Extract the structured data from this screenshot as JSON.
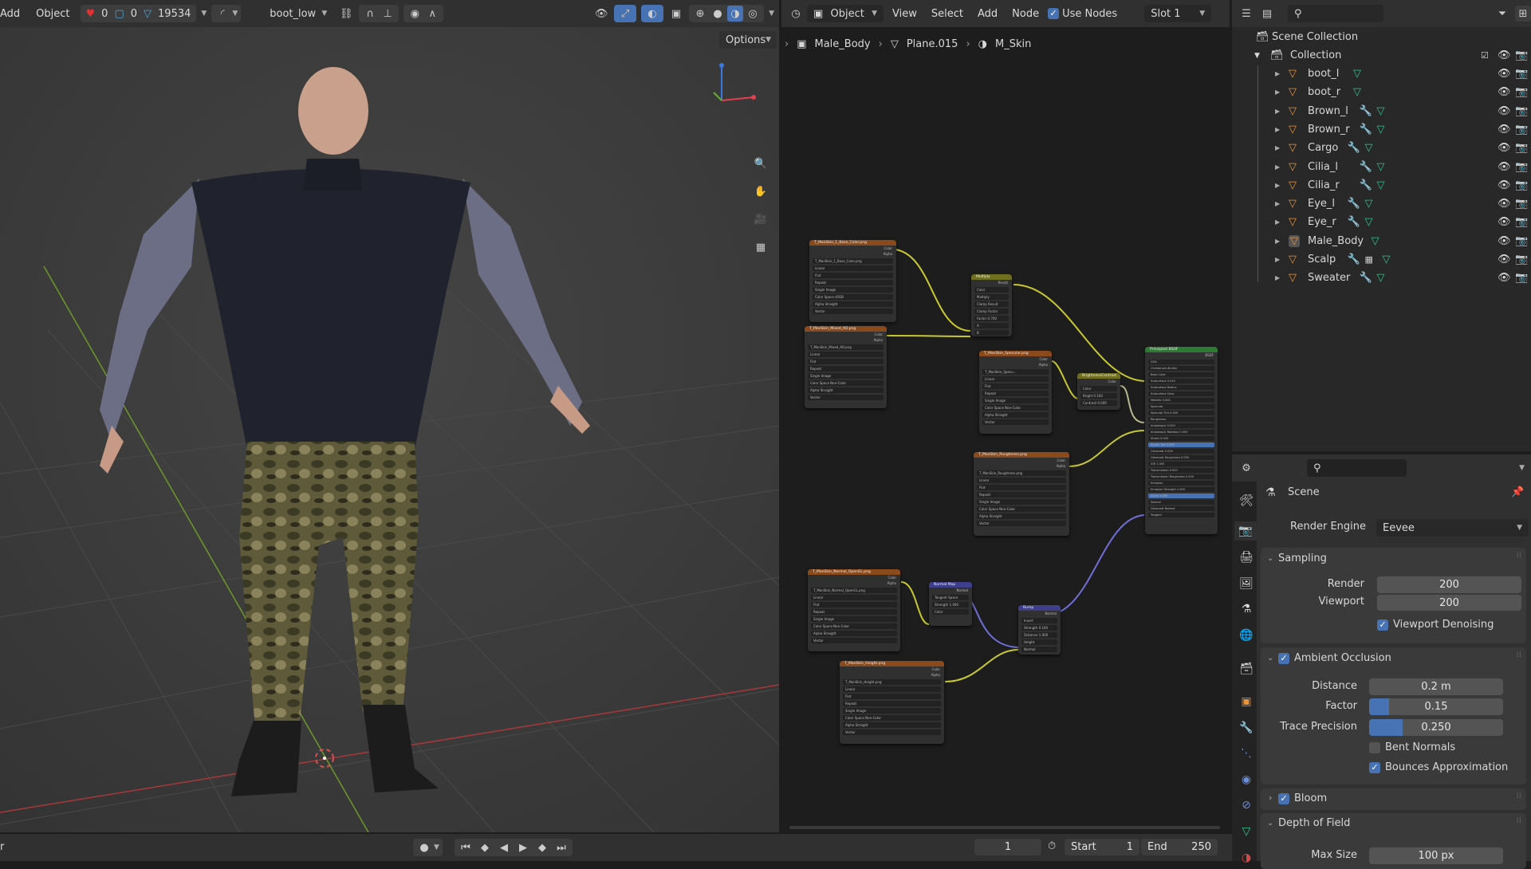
{
  "viewport_header": {
    "menus": [
      "Add",
      "Object"
    ],
    "stats": {
      "bones": "0",
      "faces": "0",
      "verts": "19534"
    },
    "object_select": "boot_low",
    "options": "Options"
  },
  "node_header": {
    "mode": "Object",
    "menus": [
      "View",
      "Select",
      "Add",
      "Node"
    ],
    "use_nodes": "Use Nodes",
    "slot": "Slot 1"
  },
  "breadcrumb": [
    "Male_Body",
    "Plane.015",
    "M_Skin"
  ],
  "nodes": [
    {
      "title": "T_ManSkin_1_Base_Color.png",
      "outputs": [
        "Color",
        "Alpha"
      ],
      "rows": [
        "T_ManSkin_1_Base_Color.png",
        "Linear",
        "Flat",
        "Repeat",
        "Single Image",
        "Color Space   sRGB",
        "Alpha   Straight",
        "Vector"
      ]
    },
    {
      "title": "T_ManSkin_Mixed_AO.png",
      "outputs": [
        "Color",
        "Alpha"
      ],
      "rows": [
        "T_ManSkin_Mixed_AO.png",
        "Linear",
        "Flat",
        "Repeat",
        "Single Image",
        "Color Space   Non-Color",
        "Alpha   Straight",
        "Vector"
      ]
    },
    {
      "title": "Multiply",
      "outputs": [
        "Result"
      ],
      "rows": [
        "Color",
        "Multiply",
        "Clamp Result",
        "Clamp Factor",
        "Factor   0.700",
        "A",
        "B"
      ]
    },
    {
      "title": "T_ManSkin_Specular.png",
      "outputs": [
        "Color",
        "Alpha"
      ],
      "rows": [
        "T_ManSkin_Specu...",
        "Linear",
        "Flat",
        "Repeat",
        "Single Image",
        "Color Space   Non-Color",
        "Alpha   Straight",
        "Vector"
      ]
    },
    {
      "title": "BrightnessContrast",
      "outputs": [
        "Color"
      ],
      "rows": [
        "Color",
        "Bright   0.100",
        "Contrast   0.000"
      ]
    },
    {
      "title": "Principled BSDF",
      "outputs": [
        "BSDF"
      ],
      "rows": [
        "GGX",
        "Christensen-Burley",
        "Base Color",
        "Subsurface   0.010",
        "Subsurface Radius",
        "Subsurface Color",
        "Metallic   0.000",
        "Specular",
        "Specular Tint   0.000",
        "Roughness",
        "Anisotropic   0.000",
        "Anisotropic Rotation   0.000",
        "Sheen   0.000",
        "Sheen Tint   0.500",
        "Clearcoat   0.000",
        "Clearcoat Roughness   0.030",
        "IOR   1.450",
        "Transmission   0.000",
        "Transmission Roughness   0.000",
        "Emission",
        "Emission Strength   1.000",
        "Alpha   1.000",
        "Normal",
        "Clearcoat Normal",
        "Tangent"
      ]
    },
    {
      "title": "T_ManSkin_Roughness.png",
      "outputs": [
        "Color",
        "Alpha"
      ],
      "rows": [
        "T_ManSkin_Roughness.png",
        "Linear",
        "Flat",
        "Repeat",
        "Single Image",
        "Color Space   Non-Color",
        "Alpha   Straight",
        "Vector"
      ]
    },
    {
      "title": "T_ManSkin_Normal_OpenGL.png",
      "outputs": [
        "Color",
        "Alpha"
      ],
      "rows": [
        "T_ManSkin_Normal_OpenGL.png",
        "Linear",
        "Flat",
        "Repeat",
        "Single Image",
        "Color Space   Non-Color",
        "Alpha   Straight",
        "Vector"
      ]
    },
    {
      "title": "Normal Map",
      "outputs": [
        "Normal"
      ],
      "rows": [
        "Tangent Space",
        "Strength   1.000",
        "Color"
      ]
    },
    {
      "title": "Bump",
      "outputs": [
        "Normal"
      ],
      "rows": [
        "Invert",
        "Strength   0.100",
        "Distance   1.000",
        "Height",
        "Normal"
      ]
    },
    {
      "title": "T_ManSkin_Height.png",
      "outputs": [
        "Color",
        "Alpha"
      ],
      "rows": [
        "T_ManSkin_Height.png",
        "Linear",
        "Flat",
        "Repeat",
        "Single Image",
        "Color Space   Non-Color",
        "Alpha   Straight",
        "Vector"
      ]
    }
  ],
  "outliner": {
    "scene_collection": "Scene Collection",
    "collection": "Collection",
    "items": [
      {
        "name": "boot_l",
        "modifier": false,
        "particles": false
      },
      {
        "name": "boot_r",
        "modifier": false,
        "particles": false
      },
      {
        "name": "Brown_l",
        "modifier": true,
        "particles": false
      },
      {
        "name": "Brown_r",
        "modifier": true,
        "particles": false
      },
      {
        "name": "Cargo",
        "modifier": true,
        "particles": false
      },
      {
        "name": "Cilia_l",
        "modifier": true,
        "particles": false
      },
      {
        "name": "Cilia_r",
        "modifier": true,
        "particles": false
      },
      {
        "name": "Eye_l",
        "modifier": true,
        "particles": false
      },
      {
        "name": "Eye_r",
        "modifier": true,
        "particles": false
      },
      {
        "name": "Male_Body",
        "modifier": false,
        "particles": false,
        "active": true
      },
      {
        "name": "Scalp",
        "modifier": true,
        "particles": true
      },
      {
        "name": "Sweater",
        "modifier": true,
        "particles": false
      }
    ]
  },
  "properties": {
    "context": "Scene",
    "render_engine_label": "Render Engine",
    "render_engine": "Eevee",
    "sampling": {
      "title": "Sampling",
      "render_label": "Render",
      "render": "200",
      "viewport_label": "Viewport",
      "viewport": "200",
      "denoise": "Viewport Denoising"
    },
    "ao": {
      "title": "Ambient Occlusion",
      "distance_label": "Distance",
      "distance": "0.2 m",
      "factor_label": "Factor",
      "factor": "0.15",
      "factor_fraction": 0.15,
      "trace_label": "Trace Precision",
      "trace": "0.250",
      "trace_fraction": 0.25,
      "bent": "Bent Normals",
      "bounces": "Bounces Approximation"
    },
    "bloom": "Bloom",
    "dof": {
      "title": "Depth of Field",
      "max_size_label": "Max Size",
      "max_size": "100 px"
    }
  },
  "timeline": {
    "left_text": "r",
    "current_frame": "1",
    "start_label": "Start",
    "start": "1",
    "end_label": "End",
    "end": "250"
  },
  "colors": {
    "accent": "#4772b3",
    "mesh": "#e8923a",
    "modifier": "#6c8ed8",
    "data": "#2fc48f",
    "tex_header": "#8a4a1c",
    "bsdf_header": "#2d7a34",
    "vector_header": "#3e3e8c",
    "color_header": "#6f6f1f"
  }
}
